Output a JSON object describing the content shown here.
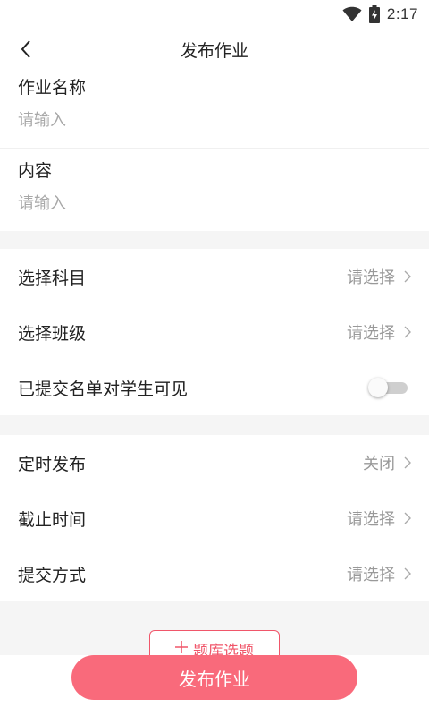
{
  "status_bar": {
    "time": "2:17",
    "icons": [
      "wifi-icon",
      "battery-charging-icon"
    ]
  },
  "nav": {
    "title": "发布作业",
    "back_icon": "back-arrow-icon"
  },
  "form": {
    "name": {
      "label": "作业名称",
      "placeholder": "请输入",
      "value": ""
    },
    "content": {
      "label": "内容",
      "placeholder": "请输入",
      "value": ""
    }
  },
  "settings": {
    "subject": {
      "label": "选择科目",
      "value": "请选择"
    },
    "class": {
      "label": "选择班级",
      "value": "请选择"
    },
    "visible_list": {
      "label": "已提交名单对学生可见",
      "toggle_on": false
    }
  },
  "schedule": {
    "timed_publish": {
      "label": "定时发布",
      "value": "关闭"
    },
    "deadline": {
      "label": "截止时间",
      "value": "请选择"
    },
    "submit_method": {
      "label": "提交方式",
      "value": "请选择"
    }
  },
  "question_bank_button": {
    "icon": "plus-icon",
    "label": "题库选题"
  },
  "publish_button": {
    "label": "发布作业"
  },
  "colors": {
    "accent": "#f96a7b",
    "accent_border": "#f0566a",
    "section_gap": "#f5f5f5",
    "placeholder": "#a8a8a8",
    "value_text": "#999999"
  }
}
